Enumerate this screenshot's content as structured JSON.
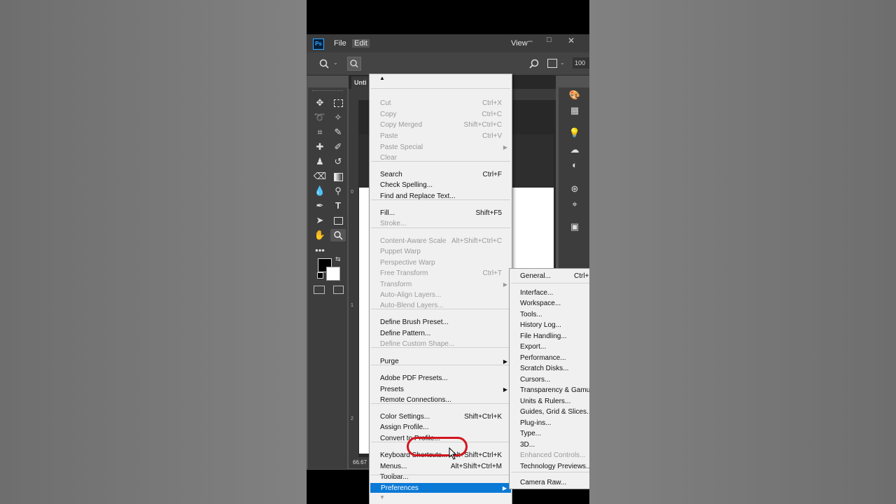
{
  "app": {
    "logo": "Ps",
    "menus": [
      "File",
      "Edit",
      "View"
    ],
    "window_controls": [
      "–",
      "□",
      "✕"
    ],
    "zoom_field": "100",
    "doc_tab": "Unti",
    "status_zoom": "66.67",
    "ruler_marks": [
      "0",
      "1",
      "2"
    ]
  },
  "edit_menu": {
    "scroll_up": "▲",
    "scroll_down": "▼",
    "items": [
      {
        "label": "Cut",
        "shortcut": "Ctrl+X",
        "disabled": true
      },
      {
        "label": "Copy",
        "shortcut": "Ctrl+C",
        "disabled": true
      },
      {
        "label": "Copy Merged",
        "shortcut": "Shift+Ctrl+C",
        "disabled": true
      },
      {
        "label": "Paste",
        "shortcut": "Ctrl+V",
        "disabled": true
      },
      {
        "label": "Paste Special",
        "shortcut": "",
        "disabled": true,
        "submenu": true
      },
      {
        "label": "Clear",
        "shortcut": "",
        "disabled": true
      },
      {
        "label": "Search",
        "shortcut": "Ctrl+F",
        "disabled": false
      },
      {
        "label": "Check Spelling...",
        "shortcut": "",
        "disabled": false
      },
      {
        "label": "Find and Replace Text...",
        "shortcut": "",
        "disabled": false
      },
      {
        "label": "Fill...",
        "shortcut": "Shift+F5",
        "disabled": false
      },
      {
        "label": "Stroke...",
        "shortcut": "",
        "disabled": true
      },
      {
        "label": "Content-Aware Scale",
        "shortcut": "Alt+Shift+Ctrl+C",
        "disabled": true
      },
      {
        "label": "Puppet Warp",
        "shortcut": "",
        "disabled": true
      },
      {
        "label": "Perspective Warp",
        "shortcut": "",
        "disabled": true
      },
      {
        "label": "Free Transform",
        "shortcut": "Ctrl+T",
        "disabled": true
      },
      {
        "label": "Transform",
        "shortcut": "",
        "disabled": true,
        "submenu": true
      },
      {
        "label": "Auto-Align Layers...",
        "shortcut": "",
        "disabled": true
      },
      {
        "label": "Auto-Blend Layers...",
        "shortcut": "",
        "disabled": true
      },
      {
        "label": "Define Brush Preset...",
        "shortcut": "",
        "disabled": false
      },
      {
        "label": "Define Pattern...",
        "shortcut": "",
        "disabled": false
      },
      {
        "label": "Define Custom Shape...",
        "shortcut": "",
        "disabled": true
      },
      {
        "label": "Purge",
        "shortcut": "",
        "disabled": false,
        "submenu": true
      },
      {
        "label": "Adobe PDF Presets...",
        "shortcut": "",
        "disabled": false
      },
      {
        "label": "Presets",
        "shortcut": "",
        "disabled": false,
        "submenu": true
      },
      {
        "label": "Remote Connections...",
        "shortcut": "",
        "disabled": false
      },
      {
        "label": "Color Settings...",
        "shortcut": "Shift+Ctrl+K",
        "disabled": false
      },
      {
        "label": "Assign Profile...",
        "shortcut": "",
        "disabled": false
      },
      {
        "label": "Convert to Profile...",
        "shortcut": "",
        "disabled": false
      },
      {
        "label": "Keyboard Shortcuts...",
        "shortcut": "Alt+Shift+Ctrl+K",
        "disabled": false
      },
      {
        "label": "Menus...",
        "shortcut": "Alt+Shift+Ctrl+M",
        "disabled": false
      },
      {
        "label": "Toolbar...",
        "shortcut": "",
        "disabled": false
      },
      {
        "label": "Preferences",
        "shortcut": "",
        "disabled": false,
        "submenu": true,
        "highlighted": true
      }
    ]
  },
  "preferences_menu": {
    "items": [
      {
        "label": "General...",
        "shortcut": "Ctrl+",
        "disabled": false
      },
      {
        "label": "Interface...",
        "shortcut": "",
        "disabled": false
      },
      {
        "label": "Workspace...",
        "shortcut": "",
        "disabled": false
      },
      {
        "label": "Tools...",
        "shortcut": "",
        "disabled": false
      },
      {
        "label": "History Log...",
        "shortcut": "",
        "disabled": false
      },
      {
        "label": "File Handling...",
        "shortcut": "",
        "disabled": false
      },
      {
        "label": "Export...",
        "shortcut": "",
        "disabled": false
      },
      {
        "label": "Performance...",
        "shortcut": "",
        "disabled": false
      },
      {
        "label": "Scratch Disks...",
        "shortcut": "",
        "disabled": false
      },
      {
        "label": "Cursors...",
        "shortcut": "",
        "disabled": false
      },
      {
        "label": "Transparency & Gamut",
        "shortcut": "",
        "disabled": false
      },
      {
        "label": "Units & Rulers...",
        "shortcut": "",
        "disabled": false
      },
      {
        "label": "Guides, Grid & Slices...",
        "shortcut": "",
        "disabled": false
      },
      {
        "label": "Plug-ins...",
        "shortcut": "",
        "disabled": false
      },
      {
        "label": "Type...",
        "shortcut": "",
        "disabled": false
      },
      {
        "label": "3D...",
        "shortcut": "",
        "disabled": false
      },
      {
        "label": "Enhanced Controls...",
        "shortcut": "",
        "disabled": true
      },
      {
        "label": "Technology Previews...",
        "shortcut": "",
        "disabled": false
      },
      {
        "label": "Camera Raw...",
        "shortcut": "",
        "disabled": false
      }
    ]
  },
  "colors": {
    "highlight": "#0a79d6",
    "annotation": "#d2161e"
  }
}
